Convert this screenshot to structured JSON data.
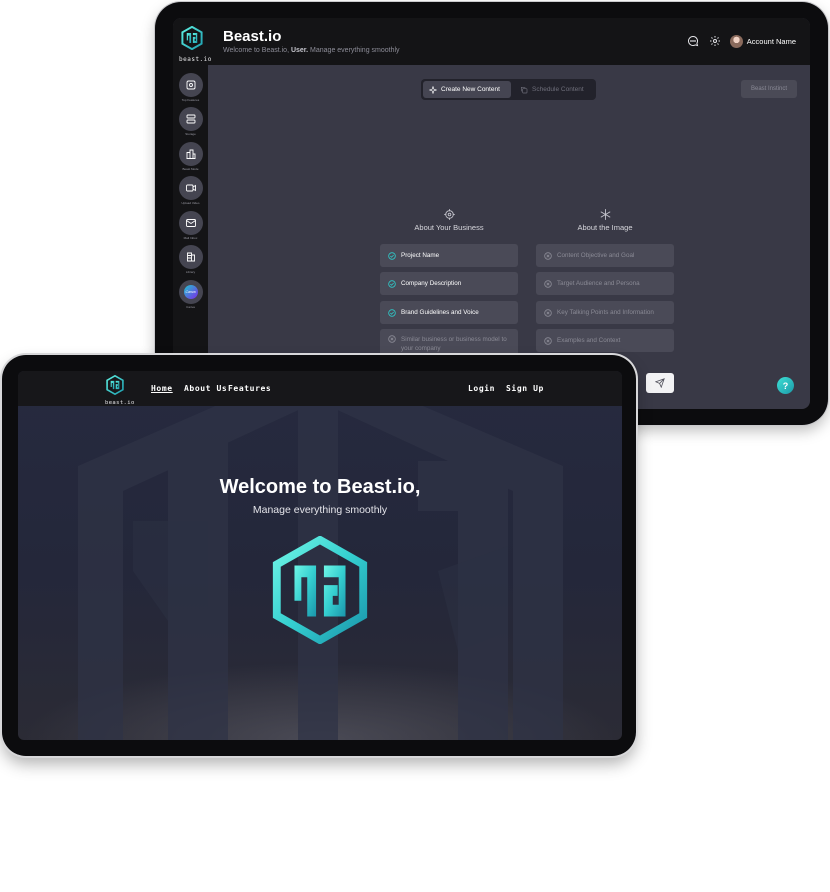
{
  "dashboard": {
    "app_name": "Beast.io",
    "logo_text": "beast.io",
    "subtitle_pre": "Welcome to Beast.io,",
    "subtitle_user": "User.",
    "subtitle_post": "Manage everything smoothly",
    "account_name": "Account Name",
    "rail_items": [
      {
        "label": "Top Features",
        "icon": "gear-box-icon"
      },
      {
        "label": "Storage",
        "icon": "server-icon"
      },
      {
        "label": "Beast Mode",
        "icon": "buildings-icon"
      },
      {
        "label": "Upload Video",
        "icon": "video-camera-icon"
      },
      {
        "label": "Mail Inbox",
        "icon": "envelope-icon"
      },
      {
        "label": "Library",
        "icon": "books-icon"
      },
      {
        "label": "Canva",
        "icon": "canva-icon"
      }
    ],
    "canva_text": "Canva",
    "tabs": {
      "create": "Create New Content",
      "schedule": "Schedule Content"
    },
    "beast_instinct": "Beast Instinct",
    "business": {
      "heading": "About Your Business",
      "items": [
        {
          "label": "Project Name",
          "checked": true
        },
        {
          "label": "Company Description",
          "checked": true
        },
        {
          "label": "Brand Guidelines and Voice",
          "checked": true
        },
        {
          "label": "Similar business or business model to your company",
          "checked": false
        }
      ]
    },
    "image": {
      "heading": "About the Image",
      "items": [
        {
          "label": "Content Objective and Goal",
          "checked": false
        },
        {
          "label": "Target Audience and Persona",
          "checked": false
        },
        {
          "label": "Key Talking Points and Information",
          "checked": false
        },
        {
          "label": "Examples and Context",
          "checked": false
        }
      ]
    },
    "help": "?",
    "accent": "#2fc9c8"
  },
  "landing": {
    "logo_text": "beast.io",
    "nav": {
      "home": "Home",
      "about": "About Us",
      "features": "Features",
      "login": "Login",
      "signup": "Sign Up"
    },
    "hero_title": "Welcome to Beast.io,",
    "hero_subtitle": "Manage everything smoothly"
  }
}
